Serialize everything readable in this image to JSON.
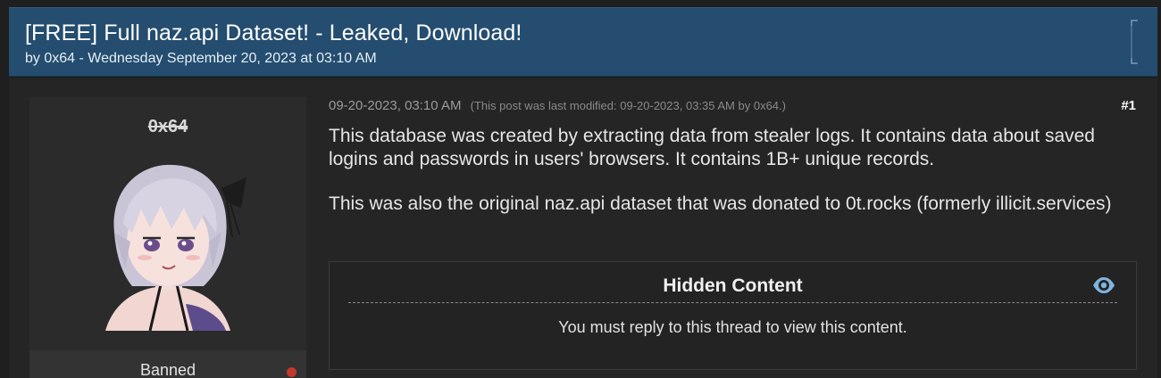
{
  "thread": {
    "title": "[FREE] Full naz.api Dataset! - Leaked, Download!",
    "byline": "by 0x64 - Wednesday September 20, 2023 at 03:10 AM"
  },
  "author": {
    "username": "0x64",
    "role": "Banned",
    "avatar_icon": "anime-character-avatar",
    "status_color": "#c0392b"
  },
  "post": {
    "timestamp": "09-20-2023, 03:10 AM",
    "modified_note": "(This post was last modified: 09-20-2023, 03:35 AM by 0x64.)",
    "number": "#1",
    "paragraphs": [
      "This database was created by extracting data from stealer logs. It contains data about saved logins and passwords in users' browsers. It contains 1B+ unique records.",
      "This was also the original naz.api dataset that was donated to 0t.rocks (formerly illicit.services)"
    ]
  },
  "hidden_content": {
    "title": "Hidden Content",
    "message": "You must reply to this thread to view this content.",
    "icon": "eye-icon"
  },
  "colors": {
    "header_bg": "#244d6f",
    "page_bg": "#1f1f1f",
    "panel_bg": "#2e2e2e",
    "accent_eye": "#7fb4e0"
  }
}
